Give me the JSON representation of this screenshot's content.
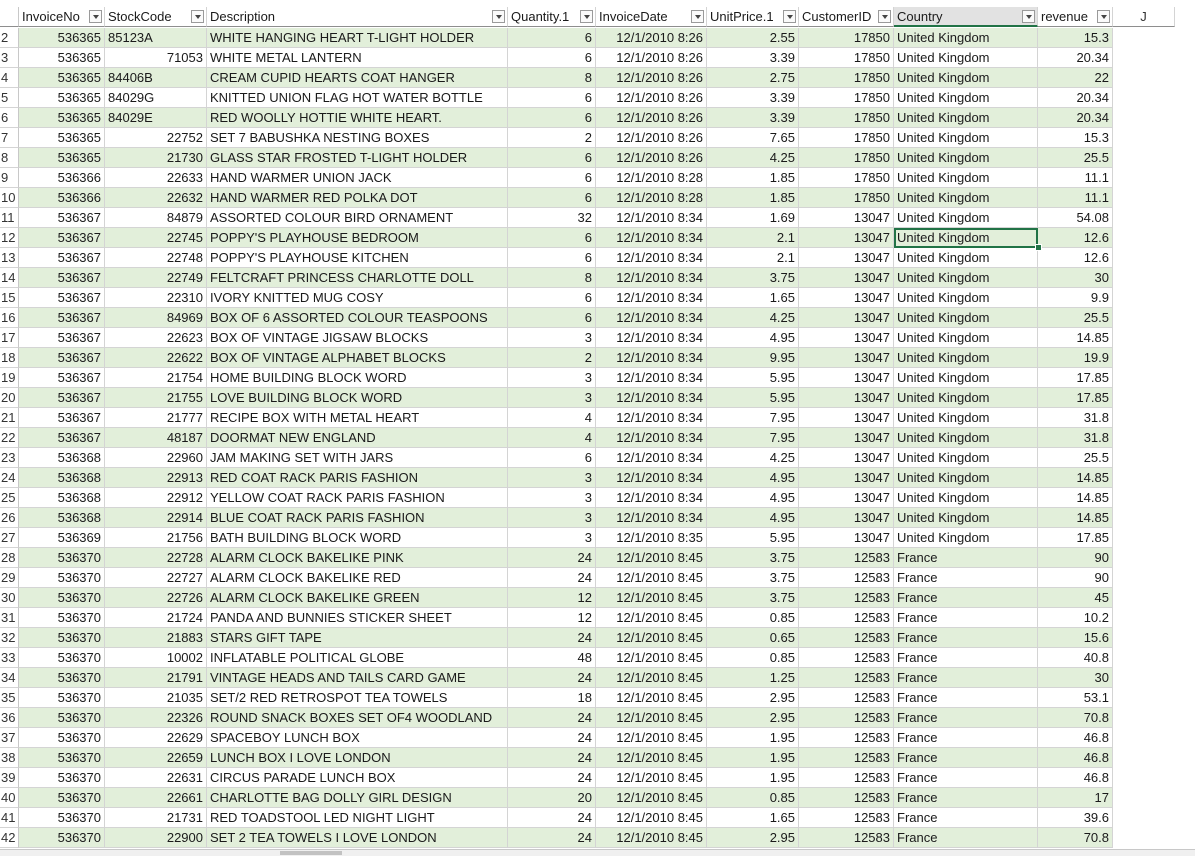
{
  "headers": [
    "InvoiceNo",
    "StockCode",
    "Description",
    "Quantity.1",
    "InvoiceDate",
    "UnitPrice.1",
    "CustomerID",
    "Country",
    "revenue",
    "J"
  ],
  "rows": [
    {
      "n": "2",
      "inv": "536365",
      "stock": "85123A",
      "desc": "WHITE HANGING HEART T-LIGHT HOLDER",
      "qty": "6",
      "date": "12/1/2010 8:26",
      "price": "2.55",
      "cust": "17850",
      "country": "United Kingdom",
      "rev": "15.3"
    },
    {
      "n": "3",
      "inv": "536365",
      "stock": "71053",
      "desc": "WHITE METAL LANTERN",
      "qty": "6",
      "date": "12/1/2010 8:26",
      "price": "3.39",
      "cust": "17850",
      "country": "United Kingdom",
      "rev": "20.34"
    },
    {
      "n": "4",
      "inv": "536365",
      "stock": "84406B",
      "desc": "CREAM CUPID HEARTS COAT HANGER",
      "qty": "8",
      "date": "12/1/2010 8:26",
      "price": "2.75",
      "cust": "17850",
      "country": "United Kingdom",
      "rev": "22"
    },
    {
      "n": "5",
      "inv": "536365",
      "stock": "84029G",
      "desc": "KNITTED UNION FLAG HOT WATER BOTTLE",
      "qty": "6",
      "date": "12/1/2010 8:26",
      "price": "3.39",
      "cust": "17850",
      "country": "United Kingdom",
      "rev": "20.34"
    },
    {
      "n": "6",
      "inv": "536365",
      "stock": "84029E",
      "desc": "RED WOOLLY HOTTIE WHITE HEART.",
      "qty": "6",
      "date": "12/1/2010 8:26",
      "price": "3.39",
      "cust": "17850",
      "country": "United Kingdom",
      "rev": "20.34"
    },
    {
      "n": "7",
      "inv": "536365",
      "stock": "22752",
      "desc": "SET 7 BABUSHKA NESTING BOXES",
      "qty": "2",
      "date": "12/1/2010 8:26",
      "price": "7.65",
      "cust": "17850",
      "country": "United Kingdom",
      "rev": "15.3"
    },
    {
      "n": "8",
      "inv": "536365",
      "stock": "21730",
      "desc": "GLASS STAR FROSTED T-LIGHT HOLDER",
      "qty": "6",
      "date": "12/1/2010 8:26",
      "price": "4.25",
      "cust": "17850",
      "country": "United Kingdom",
      "rev": "25.5"
    },
    {
      "n": "9",
      "inv": "536366",
      "stock": "22633",
      "desc": "HAND WARMER UNION JACK",
      "qty": "6",
      "date": "12/1/2010 8:28",
      "price": "1.85",
      "cust": "17850",
      "country": "United Kingdom",
      "rev": "11.1"
    },
    {
      "n": "10",
      "inv": "536366",
      "stock": "22632",
      "desc": "HAND WARMER RED POLKA DOT",
      "qty": "6",
      "date": "12/1/2010 8:28",
      "price": "1.85",
      "cust": "17850",
      "country": "United Kingdom",
      "rev": "11.1"
    },
    {
      "n": "11",
      "inv": "536367",
      "stock": "84879",
      "desc": "ASSORTED COLOUR BIRD ORNAMENT",
      "qty": "32",
      "date": "12/1/2010 8:34",
      "price": "1.69",
      "cust": "13047",
      "country": "United Kingdom",
      "rev": "54.08"
    },
    {
      "n": "12",
      "inv": "536367",
      "stock": "22745",
      "desc": "POPPY'S PLAYHOUSE BEDROOM",
      "qty": "6",
      "date": "12/1/2010 8:34",
      "price": "2.1",
      "cust": "13047",
      "country": "United Kingdom",
      "rev": "12.6"
    },
    {
      "n": "13",
      "inv": "536367",
      "stock": "22748",
      "desc": "POPPY'S PLAYHOUSE KITCHEN",
      "qty": "6",
      "date": "12/1/2010 8:34",
      "price": "2.1",
      "cust": "13047",
      "country": "United Kingdom",
      "rev": "12.6"
    },
    {
      "n": "14",
      "inv": "536367",
      "stock": "22749",
      "desc": "FELTCRAFT PRINCESS CHARLOTTE DOLL",
      "qty": "8",
      "date": "12/1/2010 8:34",
      "price": "3.75",
      "cust": "13047",
      "country": "United Kingdom",
      "rev": "30"
    },
    {
      "n": "15",
      "inv": "536367",
      "stock": "22310",
      "desc": "IVORY KNITTED MUG COSY",
      "qty": "6",
      "date": "12/1/2010 8:34",
      "price": "1.65",
      "cust": "13047",
      "country": "United Kingdom",
      "rev": "9.9"
    },
    {
      "n": "16",
      "inv": "536367",
      "stock": "84969",
      "desc": "BOX OF 6 ASSORTED COLOUR TEASPOONS",
      "qty": "6",
      "date": "12/1/2010 8:34",
      "price": "4.25",
      "cust": "13047",
      "country": "United Kingdom",
      "rev": "25.5"
    },
    {
      "n": "17",
      "inv": "536367",
      "stock": "22623",
      "desc": "BOX OF VINTAGE JIGSAW BLOCKS",
      "qty": "3",
      "date": "12/1/2010 8:34",
      "price": "4.95",
      "cust": "13047",
      "country": "United Kingdom",
      "rev": "14.85"
    },
    {
      "n": "18",
      "inv": "536367",
      "stock": "22622",
      "desc": "BOX OF VINTAGE ALPHABET BLOCKS",
      "qty": "2",
      "date": "12/1/2010 8:34",
      "price": "9.95",
      "cust": "13047",
      "country": "United Kingdom",
      "rev": "19.9"
    },
    {
      "n": "19",
      "inv": "536367",
      "stock": "21754",
      "desc": "HOME BUILDING BLOCK WORD",
      "qty": "3",
      "date": "12/1/2010 8:34",
      "price": "5.95",
      "cust": "13047",
      "country": "United Kingdom",
      "rev": "17.85"
    },
    {
      "n": "20",
      "inv": "536367",
      "stock": "21755",
      "desc": "LOVE BUILDING BLOCK WORD",
      "qty": "3",
      "date": "12/1/2010 8:34",
      "price": "5.95",
      "cust": "13047",
      "country": "United Kingdom",
      "rev": "17.85"
    },
    {
      "n": "21",
      "inv": "536367",
      "stock": "21777",
      "desc": "RECIPE BOX WITH METAL HEART",
      "qty": "4",
      "date": "12/1/2010 8:34",
      "price": "7.95",
      "cust": "13047",
      "country": "United Kingdom",
      "rev": "31.8"
    },
    {
      "n": "22",
      "inv": "536367",
      "stock": "48187",
      "desc": "DOORMAT NEW ENGLAND",
      "qty": "4",
      "date": "12/1/2010 8:34",
      "price": "7.95",
      "cust": "13047",
      "country": "United Kingdom",
      "rev": "31.8"
    },
    {
      "n": "23",
      "inv": "536368",
      "stock": "22960",
      "desc": "JAM MAKING SET WITH JARS",
      "qty": "6",
      "date": "12/1/2010 8:34",
      "price": "4.25",
      "cust": "13047",
      "country": "United Kingdom",
      "rev": "25.5"
    },
    {
      "n": "24",
      "inv": "536368",
      "stock": "22913",
      "desc": "RED COAT RACK PARIS FASHION",
      "qty": "3",
      "date": "12/1/2010 8:34",
      "price": "4.95",
      "cust": "13047",
      "country": "United Kingdom",
      "rev": "14.85"
    },
    {
      "n": "25",
      "inv": "536368",
      "stock": "22912",
      "desc": "YELLOW COAT RACK PARIS FASHION",
      "qty": "3",
      "date": "12/1/2010 8:34",
      "price": "4.95",
      "cust": "13047",
      "country": "United Kingdom",
      "rev": "14.85"
    },
    {
      "n": "26",
      "inv": "536368",
      "stock": "22914",
      "desc": "BLUE COAT RACK PARIS FASHION",
      "qty": "3",
      "date": "12/1/2010 8:34",
      "price": "4.95",
      "cust": "13047",
      "country": "United Kingdom",
      "rev": "14.85"
    },
    {
      "n": "27",
      "inv": "536369",
      "stock": "21756",
      "desc": "BATH BUILDING BLOCK WORD",
      "qty": "3",
      "date": "12/1/2010 8:35",
      "price": "5.95",
      "cust": "13047",
      "country": "United Kingdom",
      "rev": "17.85"
    },
    {
      "n": "28",
      "inv": "536370",
      "stock": "22728",
      "desc": "ALARM CLOCK BAKELIKE PINK",
      "qty": "24",
      "date": "12/1/2010 8:45",
      "price": "3.75",
      "cust": "12583",
      "country": "France",
      "rev": "90"
    },
    {
      "n": "29",
      "inv": "536370",
      "stock": "22727",
      "desc": "ALARM CLOCK BAKELIKE RED",
      "qty": "24",
      "date": "12/1/2010 8:45",
      "price": "3.75",
      "cust": "12583",
      "country": "France",
      "rev": "90"
    },
    {
      "n": "30",
      "inv": "536370",
      "stock": "22726",
      "desc": "ALARM CLOCK BAKELIKE GREEN",
      "qty": "12",
      "date": "12/1/2010 8:45",
      "price": "3.75",
      "cust": "12583",
      "country": "France",
      "rev": "45"
    },
    {
      "n": "31",
      "inv": "536370",
      "stock": "21724",
      "desc": "PANDA AND BUNNIES STICKER SHEET",
      "qty": "12",
      "date": "12/1/2010 8:45",
      "price": "0.85",
      "cust": "12583",
      "country": "France",
      "rev": "10.2"
    },
    {
      "n": "32",
      "inv": "536370",
      "stock": "21883",
      "desc": "STARS GIFT TAPE",
      "qty": "24",
      "date": "12/1/2010 8:45",
      "price": "0.65",
      "cust": "12583",
      "country": "France",
      "rev": "15.6"
    },
    {
      "n": "33",
      "inv": "536370",
      "stock": "10002",
      "desc": "INFLATABLE POLITICAL GLOBE",
      "qty": "48",
      "date": "12/1/2010 8:45",
      "price": "0.85",
      "cust": "12583",
      "country": "France",
      "rev": "40.8"
    },
    {
      "n": "34",
      "inv": "536370",
      "stock": "21791",
      "desc": "VINTAGE HEADS AND TAILS CARD GAME",
      "qty": "24",
      "date": "12/1/2010 8:45",
      "price": "1.25",
      "cust": "12583",
      "country": "France",
      "rev": "30"
    },
    {
      "n": "35",
      "inv": "536370",
      "stock": "21035",
      "desc": "SET/2 RED RETROSPOT TEA TOWELS",
      "qty": "18",
      "date": "12/1/2010 8:45",
      "price": "2.95",
      "cust": "12583",
      "country": "France",
      "rev": "53.1"
    },
    {
      "n": "36",
      "inv": "536370",
      "stock": "22326",
      "desc": "ROUND SNACK BOXES SET OF4 WOODLAND",
      "qty": "24",
      "date": "12/1/2010 8:45",
      "price": "2.95",
      "cust": "12583",
      "country": "France",
      "rev": "70.8"
    },
    {
      "n": "37",
      "inv": "536370",
      "stock": "22629",
      "desc": "SPACEBOY LUNCH BOX",
      "qty": "24",
      "date": "12/1/2010 8:45",
      "price": "1.95",
      "cust": "12583",
      "country": "France",
      "rev": "46.8"
    },
    {
      "n": "38",
      "inv": "536370",
      "stock": "22659",
      "desc": "LUNCH BOX I LOVE LONDON",
      "qty": "24",
      "date": "12/1/2010 8:45",
      "price": "1.95",
      "cust": "12583",
      "country": "France",
      "rev": "46.8"
    },
    {
      "n": "39",
      "inv": "536370",
      "stock": "22631",
      "desc": "CIRCUS PARADE LUNCH BOX",
      "qty": "24",
      "date": "12/1/2010 8:45",
      "price": "1.95",
      "cust": "12583",
      "country": "France",
      "rev": "46.8"
    },
    {
      "n": "40",
      "inv": "536370",
      "stock": "22661",
      "desc": "CHARLOTTE BAG DOLLY GIRL DESIGN",
      "qty": "20",
      "date": "12/1/2010 8:45",
      "price": "0.85",
      "cust": "12583",
      "country": "France",
      "rev": "17"
    },
    {
      "n": "41",
      "inv": "536370",
      "stock": "21731",
      "desc": "RED TOADSTOOL LED NIGHT LIGHT",
      "qty": "24",
      "date": "12/1/2010 8:45",
      "price": "1.65",
      "cust": "12583",
      "country": "France",
      "rev": "39.6"
    },
    {
      "n": "42",
      "inv": "536370",
      "stock": "22900",
      "desc": " SET 2 TEA TOWELS I LOVE LONDON",
      "qty": "24",
      "date": "12/1/2010 8:45",
      "price": "2.95",
      "cust": "12583",
      "country": "France",
      "rev": "70.8"
    }
  ],
  "selected_cell": {
    "row": "12",
    "column": "Country"
  },
  "colors": {
    "band": "#e2efda",
    "selection": "#217346",
    "grid": "#d4d4d4"
  }
}
